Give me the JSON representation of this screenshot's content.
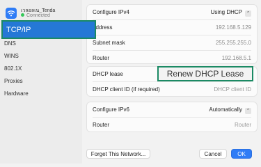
{
  "network": {
    "name": "เวลอลเน_Tenda",
    "status": "Connected"
  },
  "sidebar": {
    "items": [
      {
        "label": "TCP/IP",
        "active": true
      },
      {
        "label": "DNS"
      },
      {
        "label": "WINS"
      },
      {
        "label": "802.1X"
      },
      {
        "label": "Proxies"
      },
      {
        "label": "Hardware"
      }
    ]
  },
  "ipv4": {
    "configure_label": "Configure IPv4",
    "configure_value": "Using DHCP",
    "address_label": "address",
    "address_value": "192.168.5.129",
    "subnet_label": "Subnet mask",
    "subnet_value": "255.255.255.0",
    "router_label": "Router",
    "router_value": "192.168.5.1"
  },
  "dhcp": {
    "lease_label": "DHCP lease",
    "renew_button": "Renew DHCP Lease",
    "client_id_label": "DHCP client ID (if required)",
    "client_id_placeholder": "DHCP client ID"
  },
  "ipv6": {
    "configure_label": "Configure IPv6",
    "configure_value": "Automatically",
    "router_label": "Router",
    "router_placeholder": "Router"
  },
  "footer": {
    "forget_button": "Forget This Network...",
    "cancel_button": "Cancel",
    "ok_button": "OK"
  },
  "colors": {
    "accent": "#2f7cf6",
    "highlight_border": "#1b8a64",
    "connected": "#34c759"
  }
}
